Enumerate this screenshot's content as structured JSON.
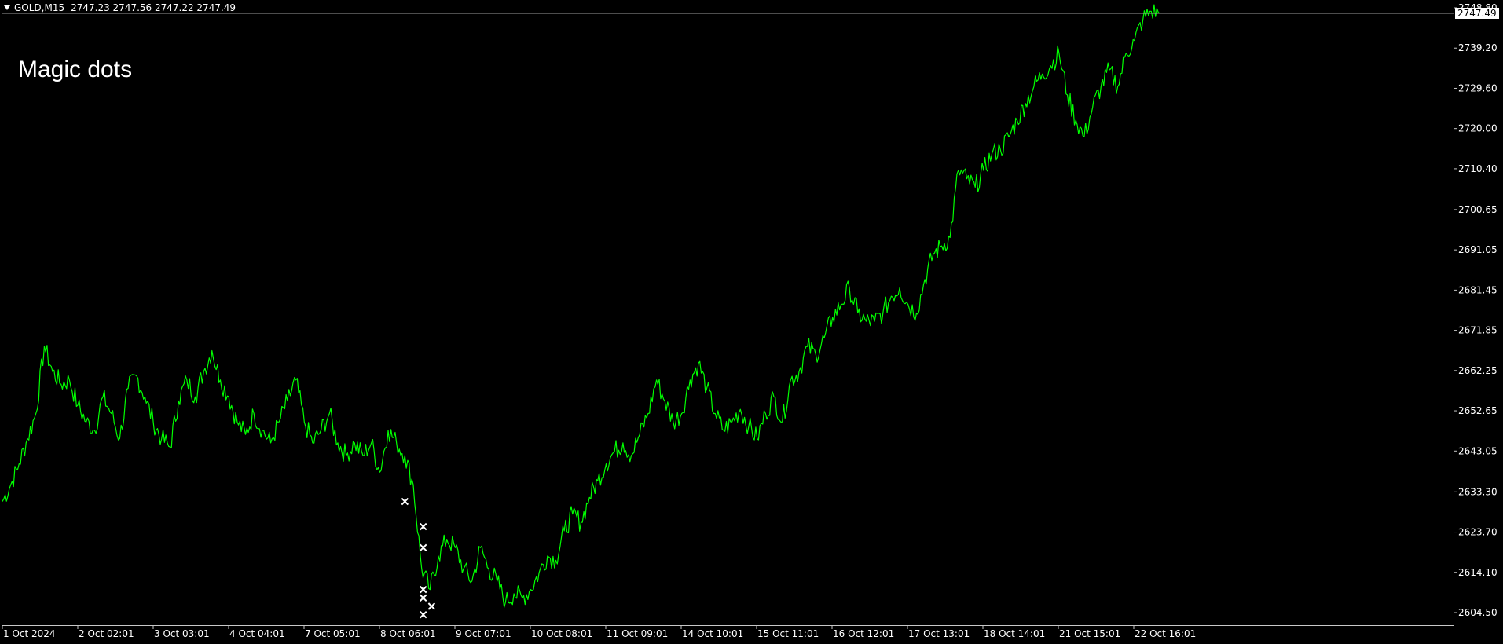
{
  "header": {
    "symbol": "GOLD,M15",
    "quotes": "2747.23 2747.56 2747.22 2747.49",
    "menu_icon": "triangle-down-icon"
  },
  "indicator_label": "Magic dots",
  "colors": {
    "background": "#000000",
    "frame": "#c8c8c8",
    "price_line": "#00ff00",
    "marker": "#ffffff",
    "last_price_label_bg": "#ffffff",
    "last_price_label_fg": "#000000"
  },
  "chart_data": {
    "type": "line",
    "title": "",
    "xlabel": "",
    "ylabel": "",
    "ylim": [
      2601.5,
      2750.3
    ],
    "y_ticks": [
      "2748.80",
      "2739.20",
      "2729.60",
      "2720.00",
      "2710.40",
      "2700.65",
      "2691.05",
      "2681.45",
      "2671.85",
      "2662.25",
      "2652.65",
      "2643.05",
      "2633.30",
      "2623.70",
      "2614.10",
      "2604.50"
    ],
    "x_tick_labels": [
      "1 Oct 2024",
      "2 Oct 02:01",
      "3 Oct 03:01",
      "4 Oct 04:01",
      "7 Oct 05:01",
      "8 Oct 06:01",
      "9 Oct 07:01",
      "10 Oct 08:01",
      "11 Oct 09:01",
      "14 Oct 10:01",
      "15 Oct 11:01",
      "16 Oct 12:01",
      "17 Oct 13:01",
      "18 Oct 14:01",
      "21 Oct 15:01",
      "22 Oct 16:01"
    ],
    "last_price": "2747.49",
    "grid": false,
    "series": [
      {
        "values": [
          2631,
          2635,
          2640,
          2646,
          2652,
          2668,
          2662,
          2659,
          2660,
          2654,
          2650,
          2648,
          2656,
          2652,
          2646,
          2658,
          2661,
          2656,
          2650,
          2646,
          2644,
          2655,
          2660,
          2656,
          2662,
          2667,
          2660,
          2656,
          2650,
          2647,
          2652,
          2648,
          2645,
          2650,
          2655,
          2660,
          2650,
          2645,
          2648,
          2652,
          2645,
          2642,
          2645,
          2642,
          2645,
          2638,
          2648,
          2645,
          2642,
          2635,
          2615,
          2610,
          2618,
          2622,
          2620,
          2615,
          2612,
          2620,
          2615,
          2612,
          2607,
          2609,
          2608,
          2610,
          2614,
          2618,
          2617,
          2624,
          2628,
          2626,
          2632,
          2636,
          2640,
          2643,
          2645,
          2642,
          2647,
          2652,
          2660,
          2655,
          2650,
          2652,
          2660,
          2664,
          2658,
          2652,
          2648,
          2650,
          2653,
          2649,
          2646,
          2652,
          2656,
          2650,
          2660,
          2662,
          2668,
          2666,
          2670,
          2675,
          2678,
          2682,
          2676,
          2674,
          2674,
          2676,
          2680,
          2682,
          2678,
          2676,
          2684,
          2690,
          2692,
          2694,
          2710,
          2708,
          2706,
          2710,
          2714,
          2715,
          2718,
          2722,
          2726,
          2730,
          2733,
          2735,
          2738,
          2728,
          2722,
          2718,
          2725,
          2730,
          2734,
          2730,
          2738,
          2741,
          2746,
          2748,
          2747.49
        ]
      }
    ],
    "markers": [
      {
        "i": 48,
        "value": 2631
      },
      {
        "i": 50,
        "value": 2625
      },
      {
        "i": 50,
        "value": 2620
      },
      {
        "i": 50,
        "value": 2610
      },
      {
        "i": 50,
        "value": 2608
      },
      {
        "i": 51,
        "value": 2606
      },
      {
        "i": 50,
        "value": 2604
      }
    ]
  }
}
